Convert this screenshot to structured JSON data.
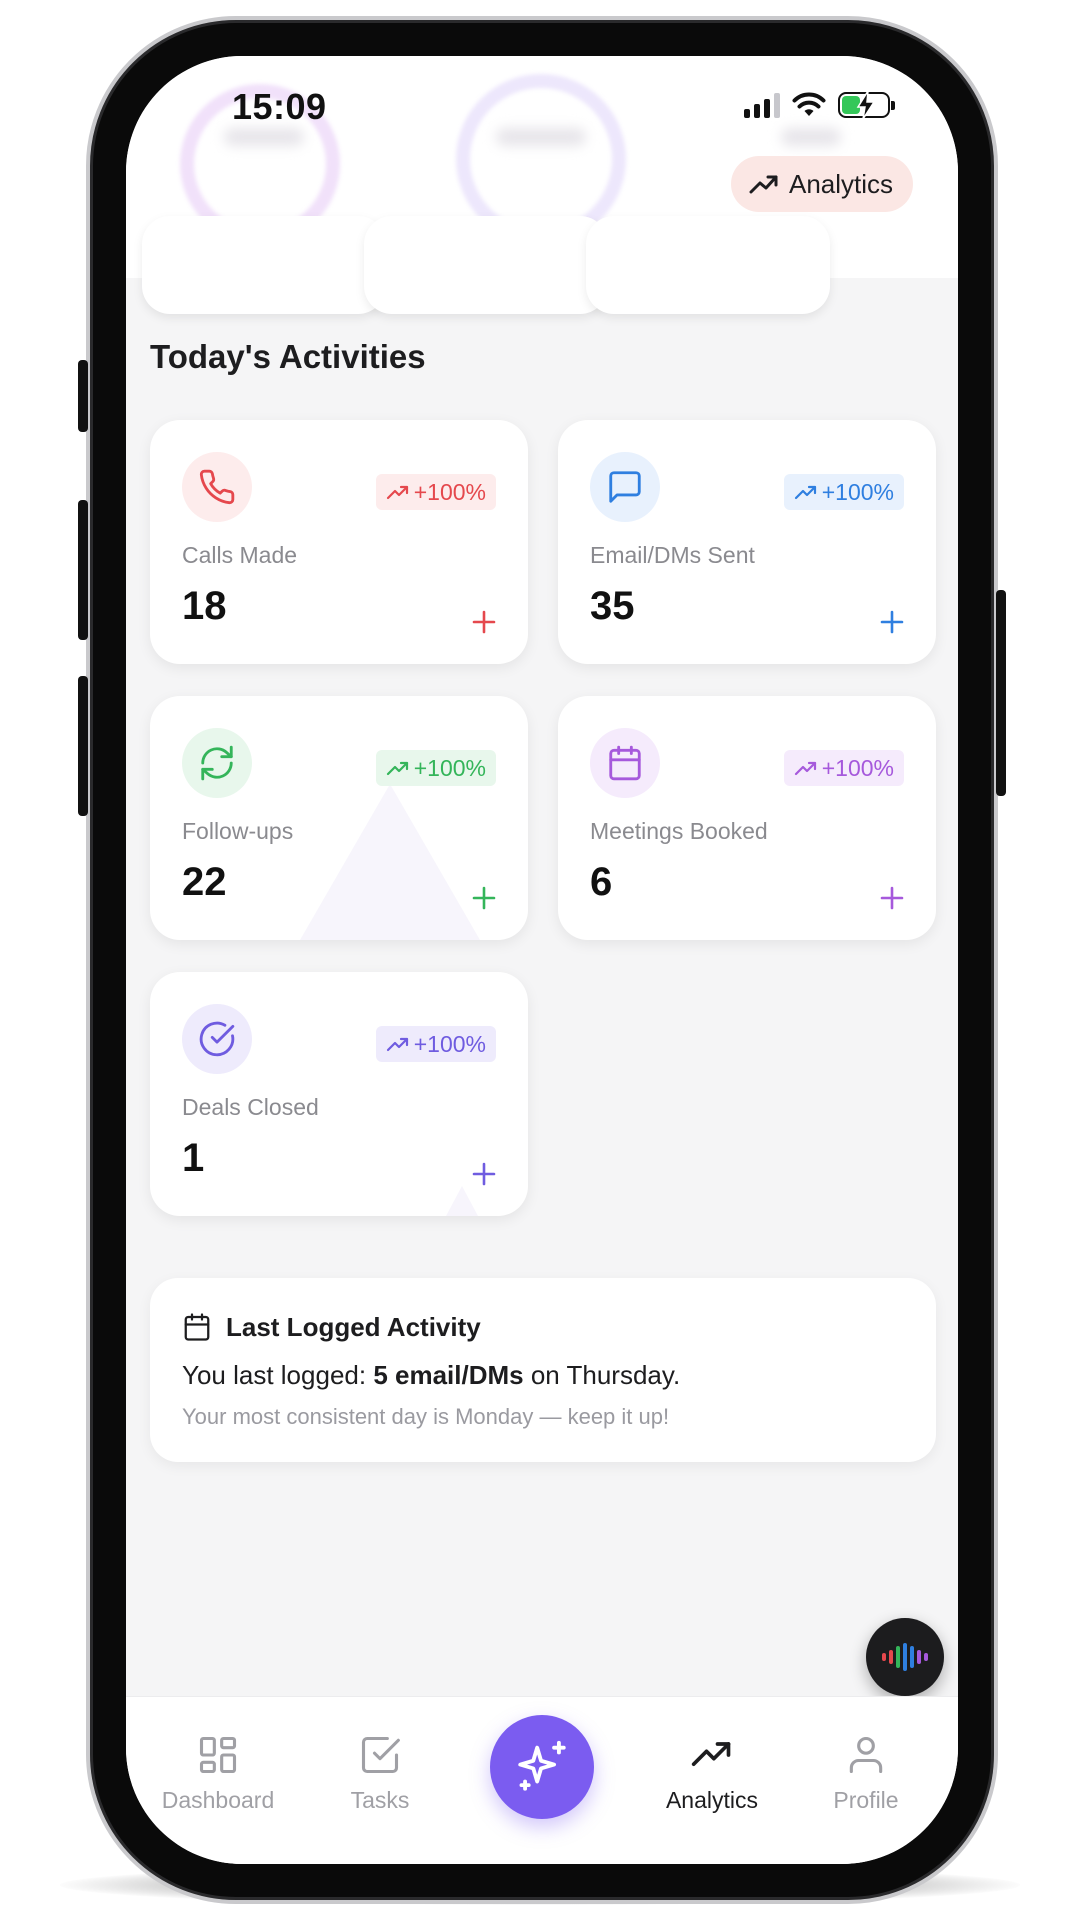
{
  "status_bar": {
    "time": "15:09"
  },
  "header": {
    "analytics_button_label": "Analytics"
  },
  "section_title": "Today's Activities",
  "activities": [
    {
      "label": "Calls Made",
      "value": "18",
      "change": "+100%",
      "icon": "phone-icon",
      "color": "#e5484d",
      "tint": "#fdecec"
    },
    {
      "label": "Email/DMs Sent",
      "value": "35",
      "change": "+100%",
      "icon": "message-icon",
      "color": "#2f7fe0",
      "tint": "#e8f1fd"
    },
    {
      "label": "Follow-ups",
      "value": "22",
      "change": "+100%",
      "icon": "refresh-icon",
      "color": "#34b55a",
      "tint": "#e8f7ec"
    },
    {
      "label": "Meetings Booked",
      "value": "6",
      "change": "+100%",
      "icon": "calendar-icon",
      "color": "#a659dc",
      "tint": "#f5ebfc"
    },
    {
      "label": "Deals Closed",
      "value": "1",
      "change": "+100%",
      "icon": "check-circle-icon",
      "color": "#6f5ce0",
      "tint": "#eeebfc"
    }
  ],
  "last_logged": {
    "title": "Last Logged Activity",
    "line_prefix": "You last logged: ",
    "line_bold": "5 email/DMs",
    "line_suffix": " on Thursday.",
    "subtitle": "Your most consistent day is Monday — keep it up!"
  },
  "nav": {
    "dashboard": "Dashboard",
    "tasks": "Tasks",
    "analytics": "Analytics",
    "profile": "Profile",
    "active": "analytics"
  },
  "colors": {
    "accent": "#7b5cf0"
  }
}
